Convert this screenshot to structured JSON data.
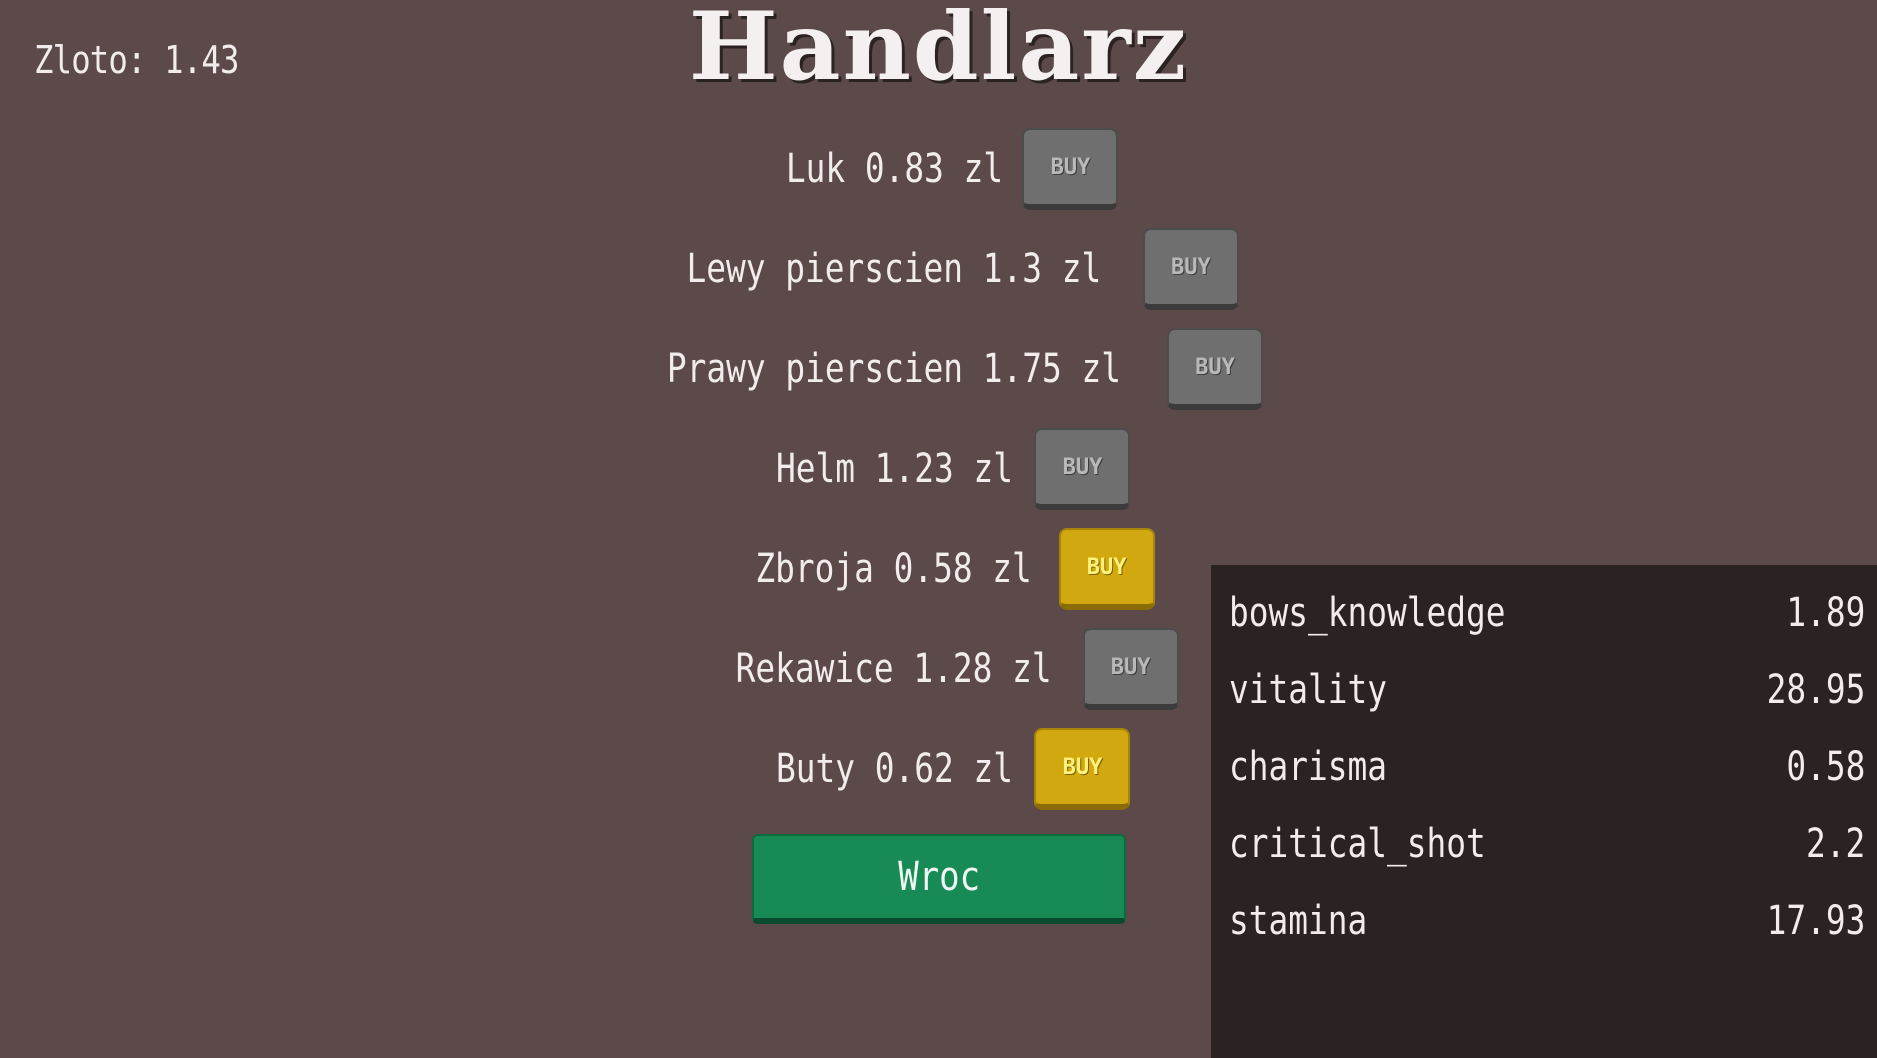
{
  "header": {
    "title": "Handlarz",
    "gold_label": "Zloto: 1.43"
  },
  "shop": {
    "items": [
      {
        "label": "Luk 0.83 zl",
        "buy_label": "BUY",
        "affordable": true
      },
      {
        "label": "Lewy pierscien  1.3 zl",
        "buy_label": "BUY",
        "affordable": true
      },
      {
        "label": "Prawy pierscien  1.75 zl",
        "buy_label": "BUY",
        "affordable": false
      },
      {
        "label": "Helm 1.23 zl",
        "buy_label": "BUY",
        "affordable": true
      },
      {
        "label": "Zbroja 0.58 zl",
        "buy_label": "BUY",
        "affordable": true
      },
      {
        "label": "Rekawice 1.28 zl",
        "buy_label": "BUY",
        "affordable": true
      },
      {
        "label": "Buty 0.62 zl",
        "buy_label": "BUY",
        "affordable": true
      }
    ],
    "back_label": "Wroc"
  },
  "stats": [
    {
      "name": "bows_knowledge",
      "value": "1.89"
    },
    {
      "name": "vitality",
      "value": "28.95"
    },
    {
      "name": "charisma",
      "value": "0.58"
    },
    {
      "name": "critical_shot",
      "value": "2.2"
    },
    {
      "name": "stamina",
      "value": "17.93"
    }
  ],
  "colors": {
    "background": "#5c4a4a",
    "panel": "#2b2222",
    "buy_gray": "#6f6f6f",
    "buy_yellow": "#d1a80f",
    "back_green": "#178a55"
  }
}
